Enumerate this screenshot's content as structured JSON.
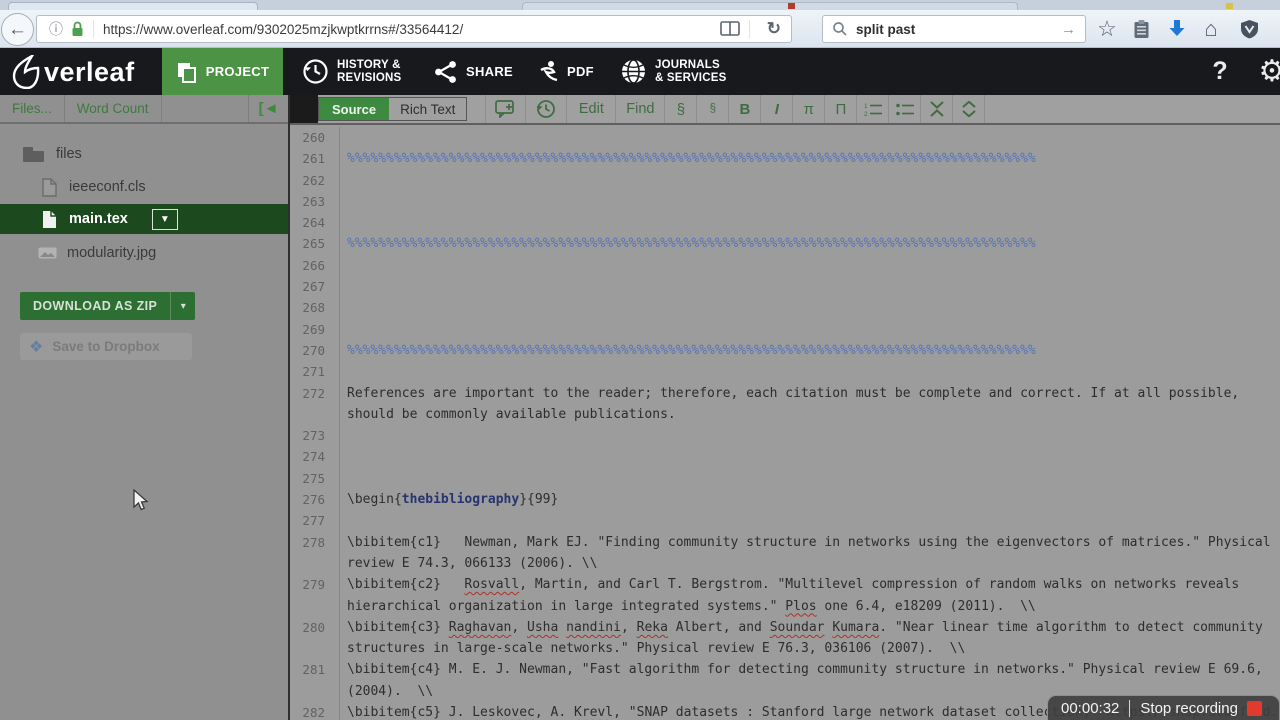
{
  "browser": {
    "url": "https://www.overleaf.com/9302025mzjkwptkrrns#/33564412/",
    "search_value": "split past"
  },
  "glyphs": {
    "back": "←",
    "info": "ⓘ",
    "reload": "↻",
    "go": "→",
    "star": "☆",
    "home": "⌂",
    "gear": "⚙",
    "help": "?",
    "caret_down": "▼",
    "caret_small": "▾",
    "dropbox": "❖",
    "collapse": "[◄"
  },
  "header": {
    "brand": "verleaf",
    "project": "PROJECT",
    "history_line1": "HISTORY &",
    "history_line2": "REVISIONS",
    "share": "SHARE",
    "pdf": "PDF",
    "journals_line1": "JOURNALS",
    "journals_line2": "& SERVICES"
  },
  "sidebar": {
    "files_btn": "Files...",
    "word_count_btn": "Word Count",
    "tree": [
      {
        "name": "files"
      },
      {
        "name": "ieeeconf.cls"
      },
      {
        "name": "main.tex"
      },
      {
        "name": "modularity.jpg"
      }
    ],
    "download_zip": "DOWNLOAD AS ZIP",
    "save_dropbox": "Save to Dropbox"
  },
  "toolbar": {
    "source": "Source",
    "rich_text": "Rich Text",
    "edit": "Edit",
    "find": "Find",
    "section": "§",
    "subsection": "§",
    "bold": "B",
    "italic": "I",
    "inline_math": "π",
    "display_math": "Π"
  },
  "editor": {
    "rows": [
      {
        "n": "260",
        "s": []
      },
      {
        "n": "261",
        "s": [
          [
            "c",
            "%%%%%%%%%%%%%%%%%%%%%%%%%%%%%%%%%%%%%%%%%%%%%%%%%%%%%%%%%%%%%%%%%%%%%%%%%%%%%%%%%%%%%%%%"
          ]
        ]
      },
      {
        "n": "262",
        "s": []
      },
      {
        "n": "263",
        "s": []
      },
      {
        "n": "264",
        "s": []
      },
      {
        "n": "265",
        "s": [
          [
            "c",
            "%%%%%%%%%%%%%%%%%%%%%%%%%%%%%%%%%%%%%%%%%%%%%%%%%%%%%%%%%%%%%%%%%%%%%%%%%%%%%%%%%%%%%%%%"
          ]
        ]
      },
      {
        "n": "266",
        "s": []
      },
      {
        "n": "267",
        "s": []
      },
      {
        "n": "268",
        "s": []
      },
      {
        "n": "269",
        "s": []
      },
      {
        "n": "270",
        "s": [
          [
            "c",
            "%%%%%%%%%%%%%%%%%%%%%%%%%%%%%%%%%%%%%%%%%%%%%%%%%%%%%%%%%%%%%%%%%%%%%%%%%%%%%%%%%%%%%%%%"
          ]
        ]
      },
      {
        "n": "271",
        "s": []
      },
      {
        "n": "272",
        "s": [
          [
            "p",
            "References are important to the reader; therefore, each citation must be complete and correct. If at all possible,"
          ]
        ]
      },
      {
        "n": "",
        "s": [
          [
            "p",
            "should be commonly available publications."
          ]
        ]
      },
      {
        "n": "273",
        "s": []
      },
      {
        "n": "274",
        "s": []
      },
      {
        "n": "275",
        "s": []
      },
      {
        "n": "276",
        "s": [
          [
            "p",
            "\\begin{"
          ],
          [
            "k",
            "thebibliography"
          ],
          [
            "p",
            "}{99}"
          ]
        ]
      },
      {
        "n": "277",
        "s": []
      },
      {
        "n": "278",
        "s": [
          [
            "p",
            "\\bibitem{c1}   Newman, Mark EJ. \"Finding community structure in networks using the eigenvectors of matrices.\" Physical"
          ]
        ]
      },
      {
        "n": "",
        "s": [
          [
            "p",
            "review E 74.3, 066133 (2006). \\\\"
          ]
        ]
      },
      {
        "n": "279",
        "s": [
          [
            "p",
            "\\bibitem{c2}   "
          ],
          [
            "m",
            "Rosvall"
          ],
          [
            "p",
            ", Martin, and Carl T. Bergstrom. \"Multilevel compression of random walks on networks reveals"
          ]
        ]
      },
      {
        "n": "",
        "s": [
          [
            "p",
            "hierarchical organization in large integrated systems.\" "
          ],
          [
            "m",
            "Plos"
          ],
          [
            "p",
            " one 6.4, e18209 (2011).  \\\\"
          ]
        ]
      },
      {
        "n": "280",
        "s": [
          [
            "p",
            "\\bibitem{c3} "
          ],
          [
            "m",
            "Raghavan"
          ],
          [
            "p",
            ", "
          ],
          [
            "m",
            "Usha"
          ],
          [
            "p",
            " "
          ],
          [
            "m",
            "nandini"
          ],
          [
            "p",
            ", "
          ],
          [
            "m",
            "Reka"
          ],
          [
            "p",
            " Albert, and "
          ],
          [
            "m",
            "Soundar"
          ],
          [
            "p",
            " "
          ],
          [
            "m",
            "Kumara"
          ],
          [
            "p",
            ". \"Near linear time algorithm to detect community"
          ]
        ]
      },
      {
        "n": "",
        "s": [
          [
            "p",
            "structures in large-scale networks.\" Physical review E 76.3, 036106 (2007).  \\\\"
          ]
        ]
      },
      {
        "n": "281",
        "s": [
          [
            "p",
            "\\bibitem{c4} M. E. J. Newman, \"Fast algorithm for detecting community structure in networks.\" Physical review E 69.6,"
          ]
        ]
      },
      {
        "n": "",
        "s": [
          [
            "p",
            "(2004).  \\\\"
          ]
        ]
      },
      {
        "n": "282",
        "s": [
          [
            "p",
            "\\bibitem{c5} J. "
          ],
          [
            "m",
            "Leskovec"
          ],
          [
            "p",
            ", A. "
          ],
          [
            "m",
            "Krevl"
          ],
          [
            "p",
            ", \"SNAP datasets : Stanford large network dataset collection,\" https://snap.stanford.edu"
          ]
        ]
      }
    ]
  },
  "recording": {
    "time": "00:00:32",
    "label": "Stop recording"
  },
  "colors": {
    "accent_green": "#4c9345",
    "selected_green": "#1c4a1e",
    "zip_green": "#2d6e33",
    "comment_blue": "#5872b4",
    "keyword_navy": "#273470",
    "stop_red": "#e23b2e"
  }
}
